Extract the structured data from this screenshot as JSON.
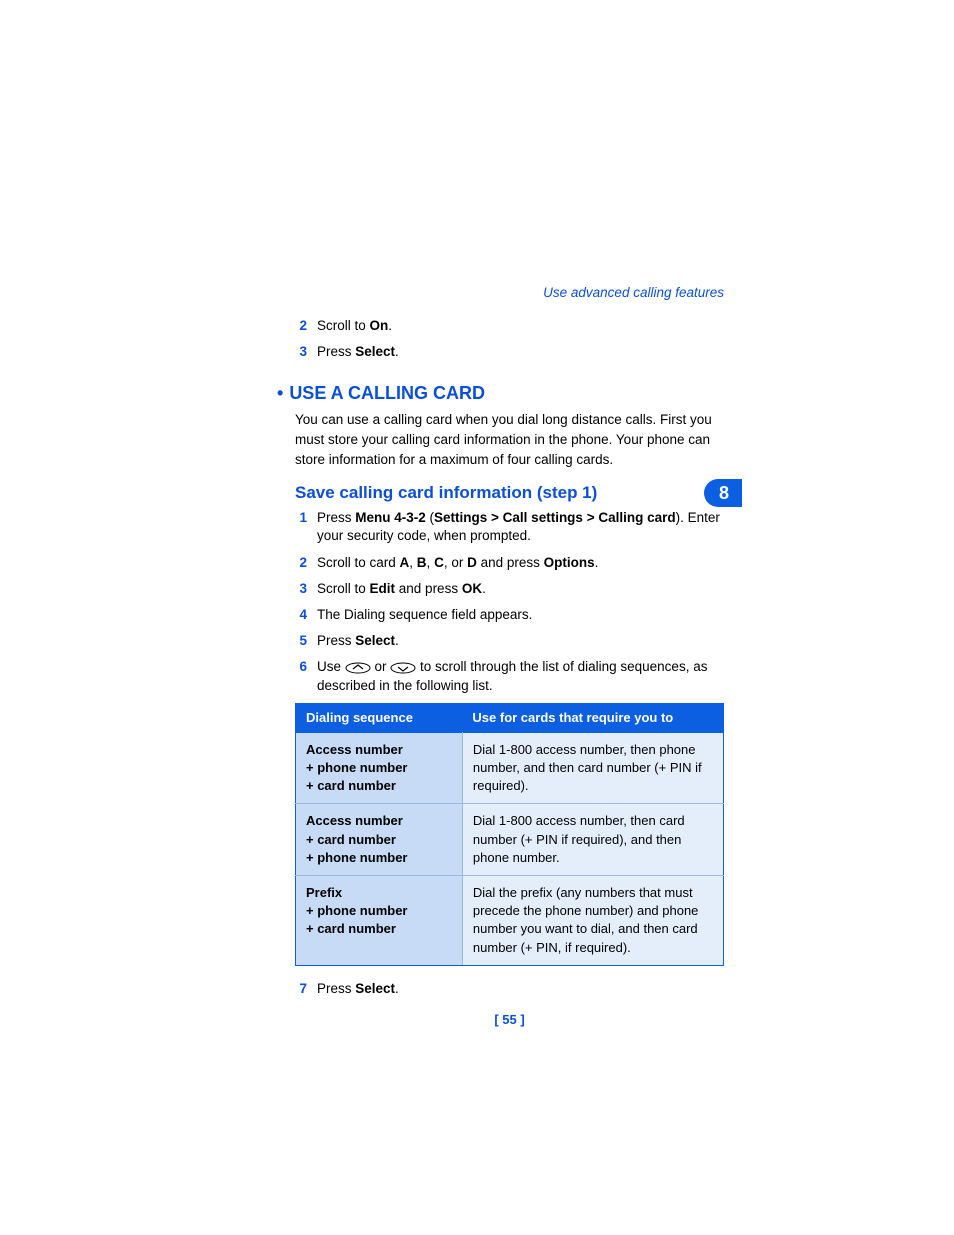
{
  "header_link": "Use advanced calling features",
  "side_tab": "8",
  "top_steps": [
    {
      "num": "2",
      "html": "Scroll to <b>On</b>."
    },
    {
      "num": "3",
      "html": "Press <b>Select</b>."
    }
  ],
  "h1": "USE A CALLING CARD",
  "intro": "You can use a calling card when you dial long distance calls. First you must store your calling card information in the phone. Your phone can store information for a maximum of four calling cards.",
  "h2": "Save calling card information (step 1)",
  "steps": [
    {
      "num": "1",
      "html": "Press <b>Menu 4-3-2</b> (<b>Settings &gt; Call settings &gt; Calling card</b>). Enter your security code, when prompted."
    },
    {
      "num": "2",
      "html": "Scroll to card <b>A</b>, <b>B</b>, <b>C</b>, or <b>D</b> and press <b>Options</b>."
    },
    {
      "num": "3",
      "html": "Scroll to <b>Edit</b> and press <b>OK</b>."
    },
    {
      "num": "4",
      "html": "The Dialing sequence field appears."
    },
    {
      "num": "5",
      "html": "Press <b>Select</b>."
    },
    {
      "num": "6",
      "html": "Use <svg class=\"key\" width=\"26\" height=\"12\" viewBox=\"0 0 26 12\"><ellipse cx=\"13\" cy=\"6\" rx=\"12\" ry=\"5\" fill=\"none\" stroke=\"#000\" stroke-width=\"1\"/><path d=\"M8 7 L13 3 L18 7\" fill=\"none\" stroke=\"#000\" stroke-width=\"1.2\"/></svg> or <svg class=\"key\" width=\"26\" height=\"12\" viewBox=\"0 0 26 12\"><ellipse cx=\"13\" cy=\"6\" rx=\"12\" ry=\"5\" fill=\"none\" stroke=\"#000\" stroke-width=\"1\"/><path d=\"M8 5 L13 9 L18 5\" fill=\"none\" stroke=\"#000\" stroke-width=\"1.2\"/></svg> to scroll through the list of dialing sequences, as described in the following list."
    }
  ],
  "table": {
    "headers": [
      "Dialing sequence",
      "Use for cards that require you to"
    ],
    "rows": [
      {
        "seq": "Access number<br>+ phone number<br>+ card number",
        "use": "Dial 1-800 access number, then phone number, and then card number (+ PIN if required)."
      },
      {
        "seq": "Access number<br>+ card number<br>+ phone number",
        "use": "Dial 1-800 access number, then card number (+ PIN if required), and then phone number."
      },
      {
        "seq": "Prefix<br>+ phone number<br>+ card number",
        "use": "Dial the prefix (any numbers that must precede the phone number) and phone number you want to dial, and then card number (+ PIN, if required)."
      }
    ]
  },
  "after_step": {
    "num": "7",
    "html": "Press <b>Select</b>."
  },
  "footer": "[ 55 ]"
}
